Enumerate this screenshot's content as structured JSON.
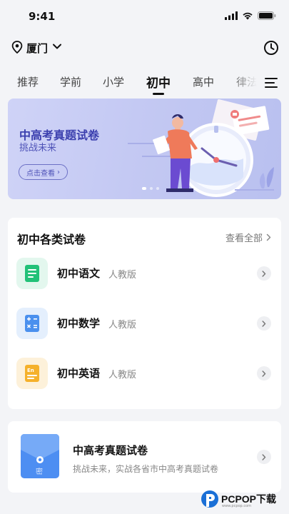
{
  "status_bar": {
    "time": "9:41"
  },
  "location": {
    "city": "厦门"
  },
  "tabs": [
    {
      "label": "推荐"
    },
    {
      "label": "学前"
    },
    {
      "label": "小学"
    },
    {
      "label": "初中",
      "active": true
    },
    {
      "label": "高中"
    },
    {
      "label": "律法"
    }
  ],
  "banner": {
    "title": "中高考真题试卷",
    "subtitle": "挑战未来",
    "button_label": "点击查看",
    "button_arrow": "›",
    "slides_total": 3,
    "slide_active": 1
  },
  "papers": {
    "title": "初中各类试卷",
    "view_all": "查看全部",
    "subjects": [
      {
        "name": "初中语文",
        "edition": "人教版",
        "icon": "chinese-book-icon",
        "color": "#22c178",
        "bg": "#e3f7ee"
      },
      {
        "name": "初中数学",
        "edition": "人教版",
        "icon": "math-calculator-icon",
        "color": "#4a90ee",
        "bg": "#e4effd"
      },
      {
        "name": "初中英语",
        "edition": "人教版",
        "icon": "english-book-icon",
        "color": "#f5b12b",
        "bg": "#fdf1da"
      }
    ]
  },
  "exam_card": {
    "title": "中高考真题试卷",
    "description": "挑战未来，实战各省市中高考真题试卷",
    "icon_glyph": "密"
  },
  "watermark": {
    "brand": "PCPOP下载",
    "url": "www.pcpop.com"
  },
  "colors": {
    "accent": "#3b3fae",
    "banner_bg": "#c4c9f3",
    "page_bg": "#f3f4f7"
  }
}
